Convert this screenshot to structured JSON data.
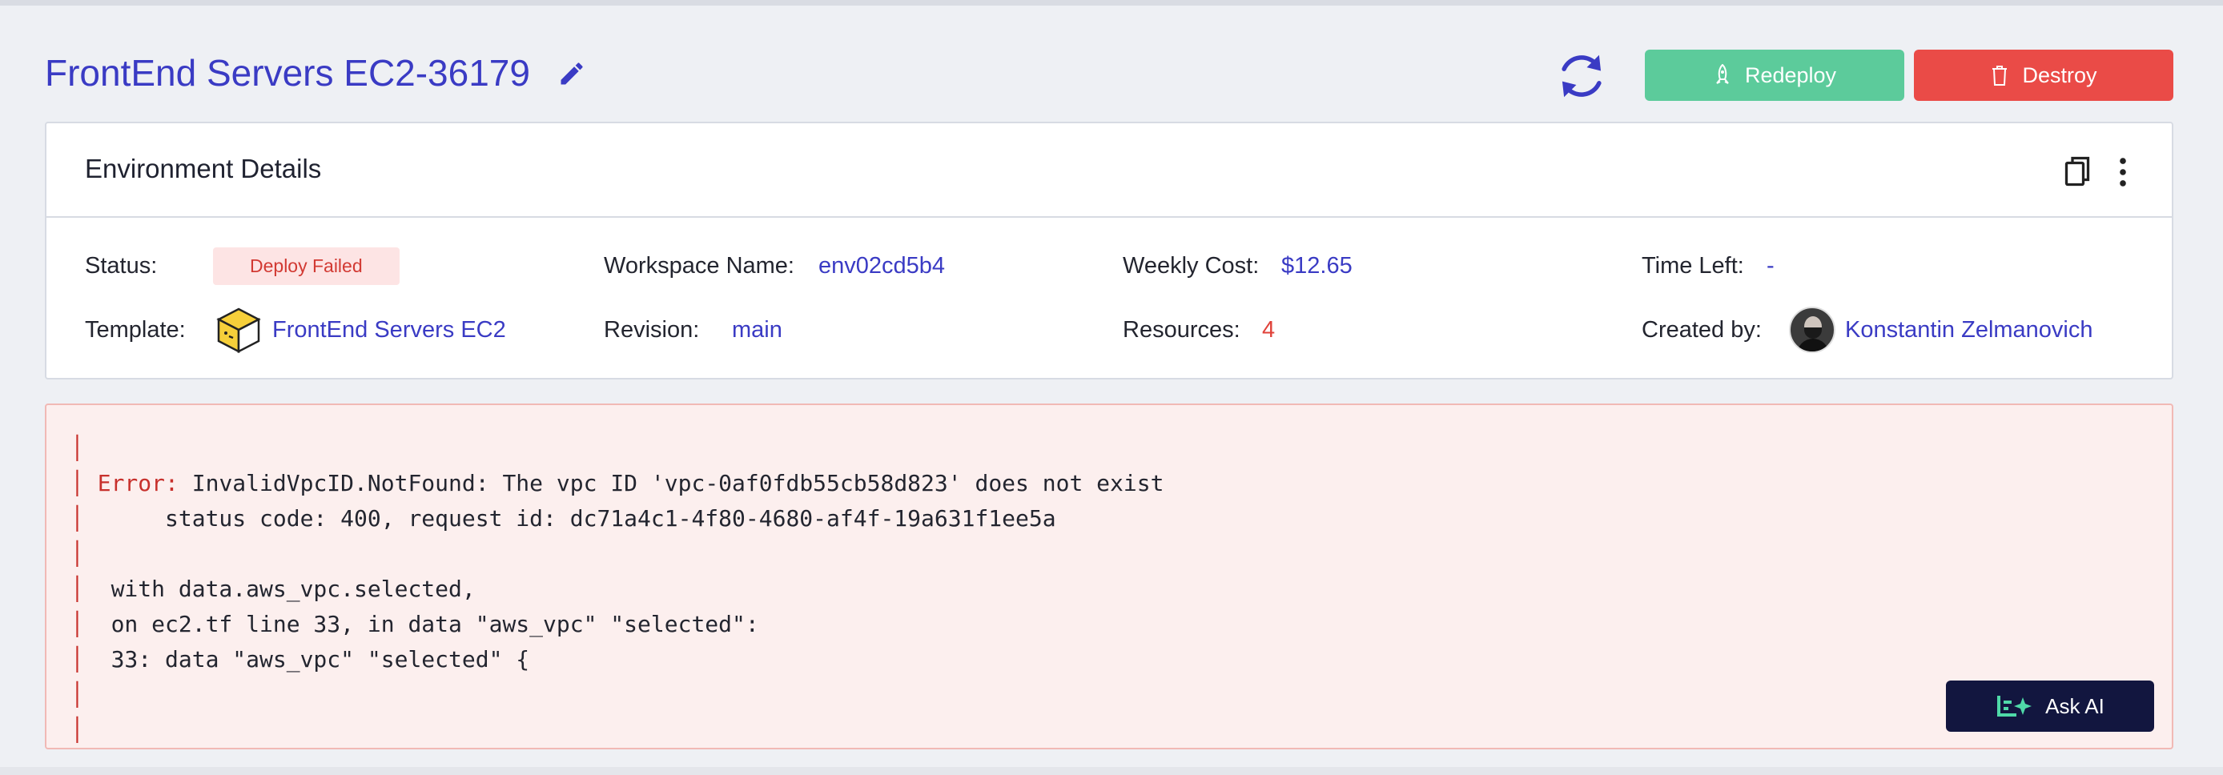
{
  "header": {
    "title": "FrontEnd Servers EC2-36179",
    "redeploy_label": "Redeploy",
    "destroy_label": "Destroy"
  },
  "card": {
    "title": "Environment Details",
    "status": {
      "label": "Status:",
      "value": "Deploy Failed"
    },
    "workspace": {
      "label": "Workspace Name:",
      "value": "env02cd5b4"
    },
    "weekly_cost": {
      "label": "Weekly Cost:",
      "value": "$12.65"
    },
    "time_left": {
      "label": "Time Left:",
      "value": "-"
    },
    "template": {
      "label": "Template:",
      "value": "FrontEnd Servers EC2"
    },
    "revision": {
      "label": "Revision:",
      "value": "main"
    },
    "resources": {
      "label": "Resources:",
      "value": "4"
    },
    "created_by": {
      "label": "Created by:",
      "value": "Konstantin Zelmanovich"
    }
  },
  "error_log": {
    "error_prefix": "Error:",
    "line1": " InvalidVpcID.NotFound: The vpc ID 'vpc-0af0fdb55cb58d823' does not exist",
    "line2": "      status code: 400, request id: dc71a4c1-4f80-4680-af4f-19a631f1ee5a",
    "line3": "  with data.aws_vpc.selected,",
    "line4": "  on ec2.tf line 33, in data \"aws_vpc\" \"selected\":",
    "line5": "  33: data \"aws_vpc\" \"selected\" {",
    "ask_ai_label": "Ask AI"
  },
  "colors": {
    "accent": "#3a3bc4",
    "redeploy": "#5ccb9b",
    "destroy": "#ea4b47",
    "error_bg": "#fcefee",
    "ask_ai_bg": "#12163f"
  }
}
